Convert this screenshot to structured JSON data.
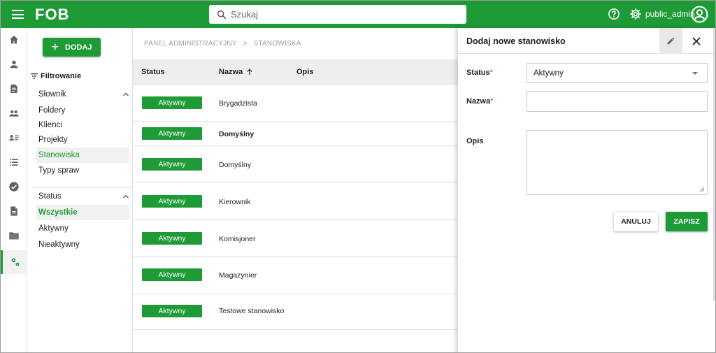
{
  "app": {
    "logo": "FOB",
    "username": "public_admin"
  },
  "search": {
    "placeholder": "Szukaj"
  },
  "colors": {
    "brand": "#1e9a36",
    "required": "#d32f2f"
  },
  "rail": {
    "icons": [
      "home-icon",
      "person-icon",
      "document-icon",
      "people-icon",
      "contacts-list-icon",
      "list-icon",
      "check-circle-icon",
      "file-icon",
      "folder-icon",
      "settings-icon"
    ],
    "active": "settings-icon"
  },
  "filters": {
    "add_label": "DODAJ",
    "title": "Filtrowanie",
    "dictionary": {
      "heading": "Słownik",
      "items": [
        "Foldery",
        "Klienci",
        "Projekty",
        "Stanowiska",
        "Typy spraw"
      ],
      "selected": "Stanowiska"
    },
    "status": {
      "heading": "Status",
      "items": [
        "Wszystkie",
        "Aktywny",
        "Nieaktywny"
      ],
      "selected": "Wszystkie"
    }
  },
  "breadcrumb": {
    "root": "PANEL ADMINISTRACYJNY",
    "separator": ">",
    "current": "STANOWISKA"
  },
  "table": {
    "columns": {
      "status": "Status",
      "name": "Nazwa",
      "description": "Opis"
    },
    "sort": {
      "column": "name",
      "direction": "ascending"
    },
    "rows": [
      {
        "status": "Aktywny",
        "name": "Brygadzista",
        "bold": false
      },
      {
        "status": "Aktywny",
        "name": "Domyślny",
        "bold": true
      },
      {
        "status": "Aktywny",
        "name": "Domyślny",
        "bold": false
      },
      {
        "status": "Aktywny",
        "name": "Kierownik",
        "bold": false
      },
      {
        "status": "Aktywny",
        "name": "Komisjoner",
        "bold": false
      },
      {
        "status": "Aktywny",
        "name": "Magazynier",
        "bold": false
      },
      {
        "status": "Aktywny",
        "name": "Testowe stanowisko",
        "bold": false
      }
    ]
  },
  "dialog": {
    "title": "Dodaj nowe stanowisko",
    "status_label": "Status",
    "status_value": "Aktywny",
    "name_label": "Nazwa",
    "name_value": "",
    "description_label": "Opis",
    "description_value": "",
    "required_mark": "*",
    "cancel_label": "ANULUJ",
    "save_label": "ZAPISZ"
  }
}
